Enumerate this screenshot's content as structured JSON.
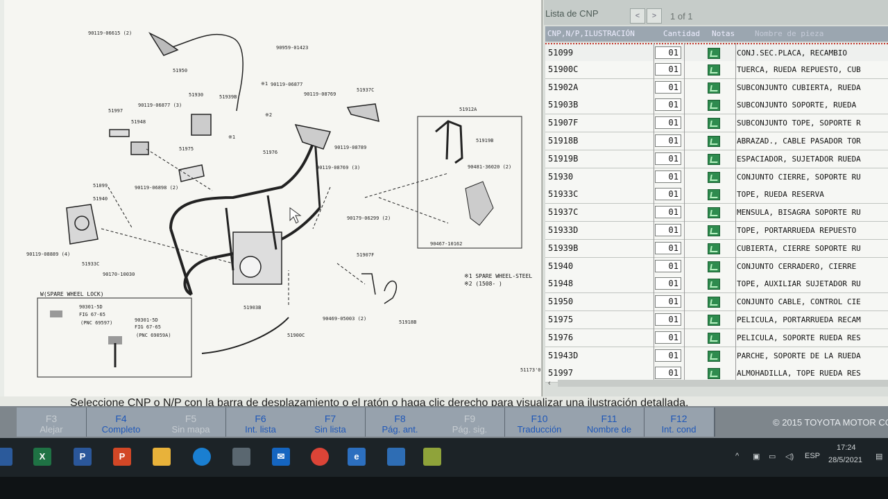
{
  "list_panel": {
    "title": "Lista de CNP",
    "prev_label": "<",
    "next_label": ">",
    "page_indicator": "1 of 1",
    "columns": [
      "CNP,N/P,ILUSTRACIÓN",
      "Cantidad",
      "Notas",
      "Nombre de pieza"
    ],
    "rows": [
      {
        "cnp": "51099",
        "qty": "01",
        "desc": "CONJ.SEC.PLACA, RECAMBIO"
      },
      {
        "cnp": "51900C",
        "qty": "01",
        "desc": "TUERCA, RUEDA REPUESTO, CUB"
      },
      {
        "cnp": "51902A",
        "qty": "01",
        "desc": "SUBCONJUNTO CUBIERTA, RUEDA"
      },
      {
        "cnp": "51903B",
        "qty": "01",
        "desc": "SUBCONJUNTO SOPORTE, RUEDA"
      },
      {
        "cnp": "51907F",
        "qty": "01",
        "desc": "SUBCONJUNTO TOPE, SOPORTE R"
      },
      {
        "cnp": "51918B",
        "qty": "01",
        "desc": "ABRAZAD., CABLE PASADOR TOR"
      },
      {
        "cnp": "51919B",
        "qty": "01",
        "desc": "ESPACIADOR, SUJETADOR RUEDA"
      },
      {
        "cnp": "51930",
        "qty": "01",
        "desc": "CONJUNTO CIERRE, SOPORTE RU"
      },
      {
        "cnp": "51933C",
        "qty": "01",
        "desc": "TOPE, RUEDA RESERVA"
      },
      {
        "cnp": "51937C",
        "qty": "01",
        "desc": "MENSULA, BISAGRA SOPORTE RU"
      },
      {
        "cnp": "51933D",
        "qty": "01",
        "desc": "TOPE, PORTARRUEDA REPUESTO"
      },
      {
        "cnp": "51939B",
        "qty": "01",
        "desc": "CUBIERTA, CIERRE SOPORTE RU"
      },
      {
        "cnp": "51940",
        "qty": "01",
        "desc": "CONJUNTO CERRADERO, CIERRE"
      },
      {
        "cnp": "51948",
        "qty": "01",
        "desc": "TOPE, AUXILIAR SUJETADOR RU"
      },
      {
        "cnp": "51950",
        "qty": "01",
        "desc": "CONJUNTO CABLE, CONTROL CIE"
      },
      {
        "cnp": "51975",
        "qty": "01",
        "desc": "PELICULA, PORTARRUEDA RECAM"
      },
      {
        "cnp": "51976",
        "qty": "01",
        "desc": "PELICULA, SOPORTE RUEDA RES"
      },
      {
        "cnp": "51943D",
        "qty": "01",
        "desc": "PARCHE, SOPORTE DE LA RUEDA"
      },
      {
        "cnp": "51997",
        "qty": "01",
        "desc": "ALMOHADILLA, TOPE RUEDA RES"
      }
    ]
  },
  "illustration": {
    "labels": [
      "90119-06615 (2)",
      "90959-01423",
      "51950",
      "90119-06877",
      "51930",
      "51939B",
      "51937C",
      "90119-08769",
      "51997",
      "90119-06877 (3)",
      "51948",
      "51975",
      "51976",
      "90119-08789",
      "51912A",
      "51919B",
      "90119-08769 (3)",
      "90119-06898 (2)",
      "51099",
      "51940",
      "90179-06299 (2)",
      "90481-36020 (2)",
      "90467-10162",
      "51907F",
      "90119-08889 (4)",
      "51933C",
      "90170-10030",
      "51903B",
      "90469-05003 (2)",
      "51918B",
      "51900C",
      "51173'0"
    ],
    "notes": [
      "※1 SPARE WHEEL-STEEL",
      "※2 (1508-     )"
    ],
    "inset_title": "W(SPARE WHEEL LOCK)",
    "inset_labels": [
      "90301-5D",
      "FIG 67-65",
      "(PNC 69597)",
      "90301-5D",
      "FIG 67-65",
      "(PNC 69059A)"
    ],
    "markers": [
      "※1",
      "※2",
      "※1"
    ]
  },
  "status_message": "Seleccione CNP o N/P con la barra de desplazamiento o el ratón o haga clic derecho para visualizar una ilustración detallada.",
  "function_keys": [
    {
      "key": "F3",
      "label": "Alejar",
      "enabled": false
    },
    {
      "key": "F4",
      "label": "Completo",
      "enabled": true
    },
    {
      "key": "F5",
      "label": "Sin mapa",
      "enabled": false
    },
    {
      "key": "F6",
      "label": "Int. lista",
      "enabled": true
    },
    {
      "key": "F7",
      "label": "Sin lista",
      "enabled": true
    },
    {
      "key": "F8",
      "label": "Pág. ant.",
      "enabled": true
    },
    {
      "key": "F9",
      "label": "Pág. sig.",
      "enabled": false
    },
    {
      "key": "F10",
      "label": "Traducción",
      "enabled": true
    },
    {
      "key": "F11",
      "label": "Nombre de",
      "enabled": true
    },
    {
      "key": "F12",
      "label": "Int. cond",
      "enabled": true
    }
  ],
  "copyright": "© 2015 TOYOTA MOTOR CO",
  "taskbar": {
    "language": "ESP",
    "time": "17:24",
    "date": "28/5/2021"
  },
  "colors": {
    "accent_blue": "#1e57b8",
    "note_green": "#2e8b4e",
    "selected_border": "#c2372c"
  }
}
